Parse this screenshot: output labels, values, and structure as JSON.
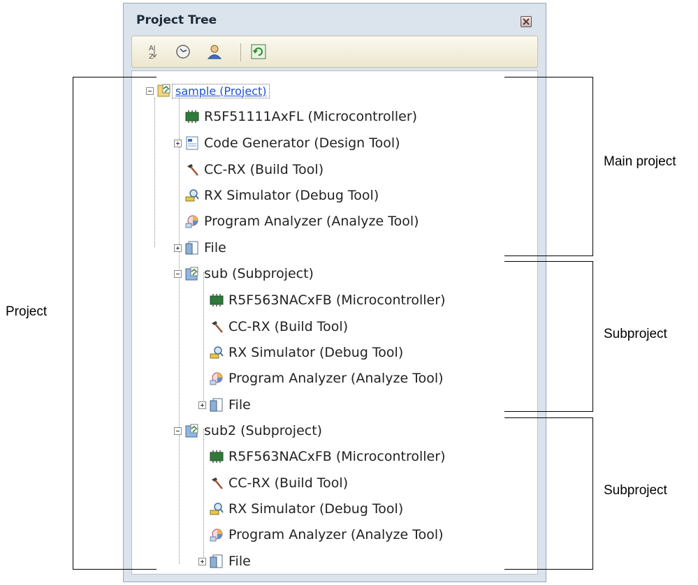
{
  "panel": {
    "title": "Project Tree",
    "toolbar": {
      "buttons": [
        {
          "name": "sort-icon"
        },
        {
          "name": "property-icon"
        },
        {
          "name": "user-icon"
        },
        {
          "name": "refresh-icon"
        }
      ]
    }
  },
  "tree": {
    "root": "sample (Project)",
    "main_items": [
      "R5F51111AxFL (Microcontroller)",
      "Code Generator (Design Tool)",
      "CC-RX (Build Tool)",
      "RX Simulator (Debug Tool)",
      "Program Analyzer (Analyze Tool)",
      "File"
    ],
    "sub1": {
      "label": "sub (Subproject)",
      "items": [
        "R5F563NACxFB (Microcontroller)",
        "CC-RX (Build Tool)",
        "RX Simulator (Debug Tool)",
        "Program Analyzer (Analyze Tool)",
        "File"
      ]
    },
    "sub2": {
      "label": "sub2 (Subproject)",
      "items": [
        "R5F563NACxFB (Microcontroller)",
        "CC-RX (Build Tool)",
        "RX Simulator (Debug Tool)",
        "Program Analyzer (Analyze Tool)",
        "File"
      ]
    }
  },
  "annotations": {
    "project": "Project",
    "main_project": "Main project",
    "subproject_1": "Subproject",
    "subproject_2": "Subproject"
  }
}
